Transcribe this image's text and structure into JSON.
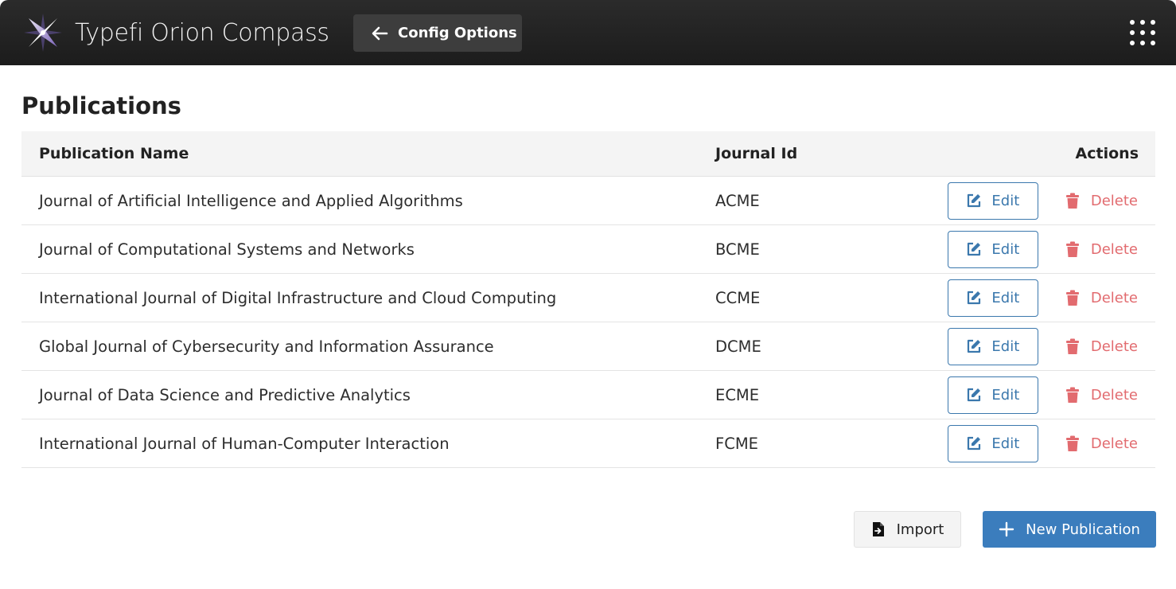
{
  "header": {
    "app_name": "Typefi Orion Compass",
    "back_label": "Config Options"
  },
  "page": {
    "title": "Publications"
  },
  "table": {
    "columns": [
      "Publication Name",
      "Journal Id",
      "Actions"
    ],
    "rows": [
      {
        "name": "Journal of Artificial Intelligence and Applied Algorithms",
        "id": "ACME"
      },
      {
        "name": "Journal of Computational Systems and Networks",
        "id": "BCME"
      },
      {
        "name": "International Journal of Digital Infrastructure and Cloud Computing",
        "id": "CCME"
      },
      {
        "name": "Global Journal of Cybersecurity and Information Assurance",
        "id": "DCME"
      },
      {
        "name": "Journal of Data Science and Predictive Analytics",
        "id": "ECME"
      },
      {
        "name": "International Journal of Human-Computer Interaction",
        "id": "FCME"
      }
    ],
    "edit_label": "Edit",
    "delete_label": "Delete"
  },
  "footer": {
    "import_label": "Import",
    "new_label": "New Publication"
  },
  "icons": {
    "logo": "compass-star-logo",
    "back": "arrow-left-icon",
    "apps": "grid-dots-icon",
    "edit": "edit-icon",
    "delete": "trash-icon",
    "import": "file-import-icon",
    "new": "plus-icon"
  },
  "colors": {
    "header_bg": "#222222",
    "primary": "#3b7dbd",
    "edit": "#3b78ad",
    "delete": "#e26b6f"
  }
}
